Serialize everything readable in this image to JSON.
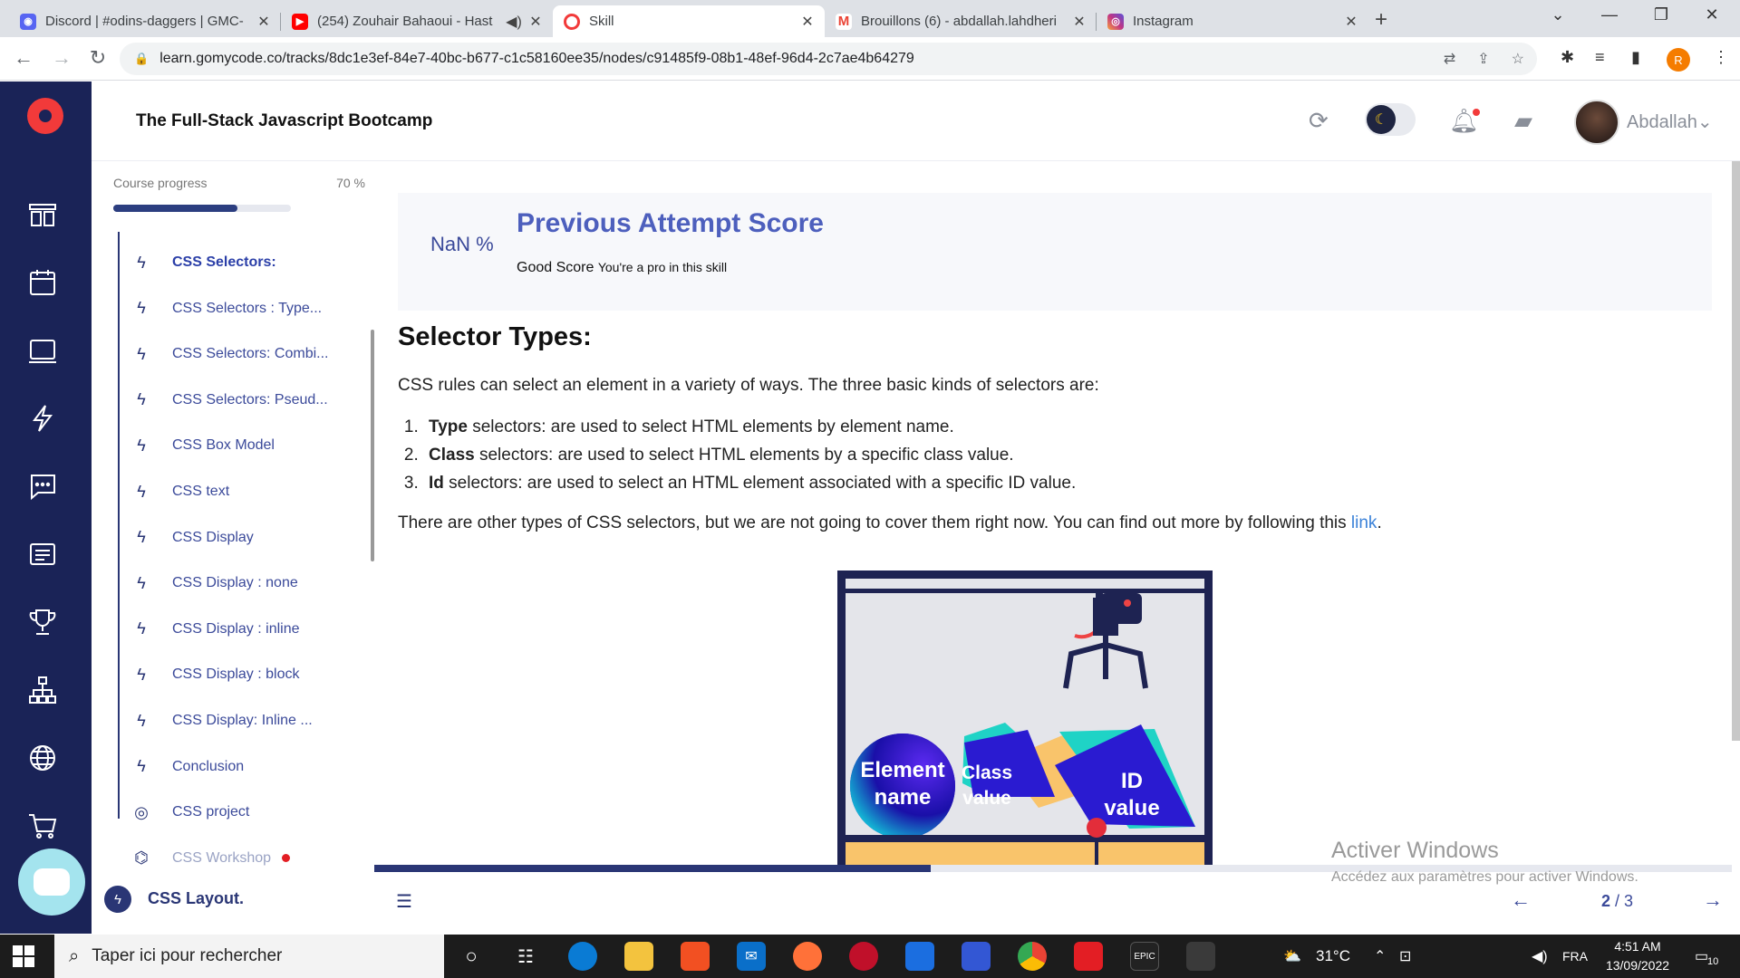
{
  "browser": {
    "tabs": [
      {
        "title": "Discord | #odins-daggers | GMC-",
        "icon": "discord-icon",
        "color": "#5865f2"
      },
      {
        "title": "(254) Zouhair Bahaoui - Hast",
        "icon": "youtube-icon",
        "color": "#ff0000"
      },
      {
        "title": "Skill",
        "icon": "gomycode-icon",
        "color": "#f23a3a"
      },
      {
        "title": "Brouillons (6) - abdallah.lahdheri",
        "icon": "gmail-icon",
        "color": "#ea4335"
      },
      {
        "title": "Instagram",
        "icon": "instagram-icon",
        "color": "#c13584"
      }
    ],
    "url": "learn.gomycode.co/tracks/8dc1e3ef-84e7-40bc-b677-c1c58160ee35/nodes/c91485f9-08b1-48ef-96d4-2c7ae4b64279",
    "profile_initial": "R"
  },
  "app": {
    "title": "The Full-Stack Javascript Bootcamp",
    "username": "Abdallah",
    "brand_color": "#1a2357",
    "accent": "#f23a3a"
  },
  "sidebar": {
    "progress_label": "Course progress",
    "progress_value": "70 %",
    "progress_fraction": 0.7,
    "lessons": [
      {
        "label": "CSS Selectors:",
        "icon": "bolt-icon",
        "state": "current"
      },
      {
        "label": "CSS Selectors : Type...",
        "icon": "bolt-icon",
        "state": "normal"
      },
      {
        "label": "CSS Selectors: Combi...",
        "icon": "bolt-icon",
        "state": "normal"
      },
      {
        "label": "CSS Selectors: Pseud...",
        "icon": "bolt-icon",
        "state": "normal"
      },
      {
        "label": "CSS Box Model",
        "icon": "bolt-icon",
        "state": "normal"
      },
      {
        "label": "CSS text",
        "icon": "bolt-icon",
        "state": "normal"
      },
      {
        "label": "CSS Display",
        "icon": "bolt-icon",
        "state": "normal"
      },
      {
        "label": "CSS Display : none",
        "icon": "bolt-icon",
        "state": "normal"
      },
      {
        "label": "CSS Display : inline",
        "icon": "bolt-icon",
        "state": "normal"
      },
      {
        "label": "CSS Display : block",
        "icon": "bolt-icon",
        "state": "normal"
      },
      {
        "label": "CSS Display: Inline ...",
        "icon": "bolt-icon",
        "state": "normal"
      },
      {
        "label": "Conclusion",
        "icon": "bolt-icon",
        "state": "normal"
      },
      {
        "label": "CSS project",
        "icon": "target-icon",
        "state": "normal"
      },
      {
        "label": "CSS Workshop",
        "icon": "workshop-icon",
        "state": "faded"
      }
    ],
    "next_section": "CSS Layout."
  },
  "score": {
    "percent": "NaN %",
    "title": "Previous Attempt Score",
    "rating": "Good Score",
    "message": "You're a pro in this skill"
  },
  "article": {
    "heading": "Selector Types:",
    "intro": "CSS rules can select an element in a variety of ways. The three basic kinds of selectors are:",
    "list": [
      {
        "bold": "Type",
        "text": " selectors: are used to select HTML elements by element name."
      },
      {
        "bold": "Class",
        "text": " selectors: are used to select HTML elements by a specific class value."
      },
      {
        "bold": "Id",
        "text": " selectors: are used to select an HTML element associated with a specific ID value."
      }
    ],
    "outro": "There are other types of CSS selectors, but we are not going to cover them right now. You can find out more by following this ",
    "link_text": "link",
    "outro_end": ".",
    "illustration": {
      "element": [
        "Element",
        "name"
      ],
      "class": [
        "Class",
        "value"
      ],
      "id": [
        "ID",
        "value"
      ]
    }
  },
  "pager": {
    "current": "2",
    "sep": " / ",
    "total": "3",
    "progress_fraction": 0.41
  },
  "watermark": {
    "title": "Activer Windows",
    "subtitle": "Accédez aux paramètres pour activer Windows."
  },
  "taskbar": {
    "search_placeholder": "Taper ici pour rechercher",
    "temperature": "31°C",
    "language": "FRA",
    "time": "4:51 AM",
    "date": "13/09/2022",
    "notifications": "10"
  }
}
